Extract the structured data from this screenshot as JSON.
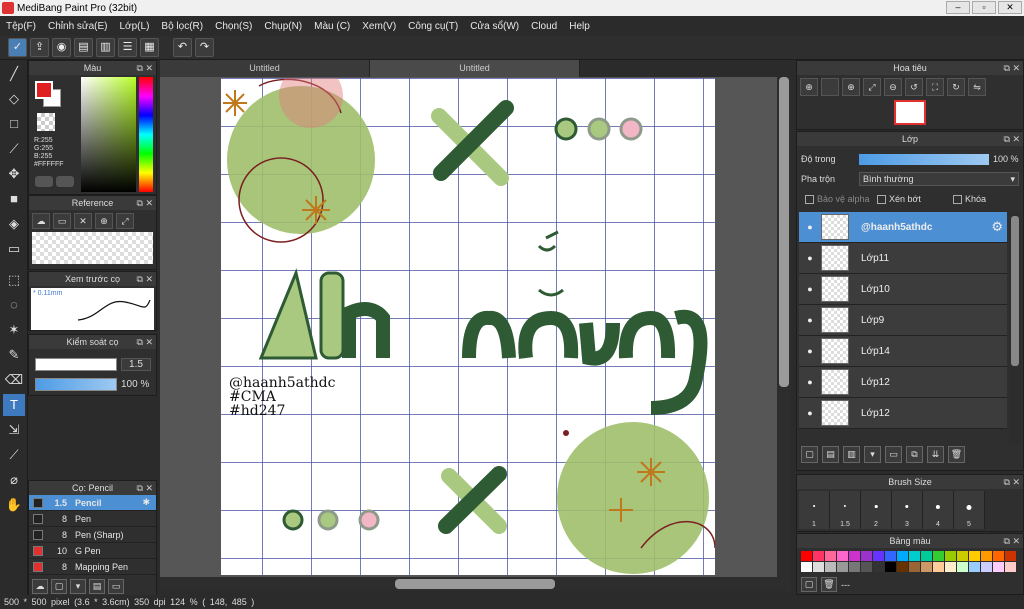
{
  "window": {
    "title": "MediBang Paint Pro (32bit)"
  },
  "menu": [
    "Tệp(F)",
    "Chỉnh sửa(E)",
    "Lớp(L)",
    "Bộ lọc(R)",
    "Chọn(S)",
    "Chụp(N)",
    "Màu (C)",
    "Xem(V)",
    "Công cụ(T)",
    "Cửa sổ(W)",
    "Cloud",
    "Help"
  ],
  "doc_tabs": [
    "Untitled",
    "Untitled"
  ],
  "color_panel": {
    "title": "Màu",
    "r": "R:255",
    "g": "G:255",
    "b": "B:255",
    "hex": "#FFFFFF",
    "fg_color": "#e02020",
    "bg_color": "#ffffff"
  },
  "reference_panel": {
    "title": "Reference"
  },
  "preview_panel": {
    "title": "Xem trước cọ",
    "size": "0.11mm"
  },
  "brush_control": {
    "title": "Kiểm soát cọ",
    "size_value": "1.5",
    "opacity_value": "100 %",
    "opacity": 1.0
  },
  "brush_list": {
    "title": "Cọ: Pencil",
    "items": [
      {
        "size": "1.5",
        "name": "Pencil",
        "color": "#222222",
        "selected": true
      },
      {
        "size": "8",
        "name": "Pen",
        "color": "#222222",
        "selected": false
      },
      {
        "size": "8",
        "name": "Pen (Sharp)",
        "color": "#222222",
        "selected": false
      },
      {
        "size": "10",
        "name": "G Pen",
        "color": "#e03030",
        "selected": false
      },
      {
        "size": "8",
        "name": "Mapping Pen",
        "color": "#e03030",
        "selected": false
      }
    ]
  },
  "canvas": {
    "title_art": "Ảnh nắng",
    "caption_lines": [
      "@haanh5athdc",
      "#CMA",
      "#hd247"
    ],
    "grid_color": "#4650a0",
    "accent_green": "#aacc88",
    "dark_green": "#2e5a34"
  },
  "status": {
    "size": "500 * 500 pixel",
    "cm": "(3.6 * 3.6cm)",
    "dpi": "350 dpi",
    "zoom": "124 %",
    "coords": "( 148, 485 )"
  },
  "navigator": {
    "title": "Hoa tiêu"
  },
  "layer_panel": {
    "title": "Lớp",
    "opacity_label": "Độ trong",
    "opacity_value": "100 %",
    "opacity": 1.0,
    "blend_label": "Pha trộn",
    "blend_value": "Bình thường",
    "protect_alpha": "Bảo vệ alpha",
    "clipping": "Xén bớt",
    "lock": "Khóa",
    "layers": [
      {
        "name": "@haanh5athdc",
        "selected": true
      },
      {
        "name": "Lớp11",
        "selected": false
      },
      {
        "name": "Lớp10",
        "selected": false
      },
      {
        "name": "Lớp9",
        "selected": false
      },
      {
        "name": "Lớp14",
        "selected": false
      },
      {
        "name": "Lớp12",
        "selected": false
      },
      {
        "name": "Lớp12",
        "selected": false
      }
    ]
  },
  "brush_size_panel": {
    "title": "Brush Size",
    "sizes": [
      1,
      1.5,
      2,
      3,
      4,
      5
    ]
  },
  "palette_panel": {
    "title": "Bảng màu",
    "footer_text": "---",
    "colors": [
      "#ff0000",
      "#ff3366",
      "#ff6699",
      "#ff66cc",
      "#cc33cc",
      "#9933cc",
      "#6633ff",
      "#3366ff",
      "#00aaff",
      "#00cccc",
      "#00cc99",
      "#33cc33",
      "#99cc00",
      "#cccc00",
      "#ffcc00",
      "#ff9900",
      "#ff6600",
      "#cc3300",
      "#ffffff",
      "#dddddd",
      "#bbbbbb",
      "#999999",
      "#777777",
      "#555555",
      "#333333",
      "#000000",
      "#663300",
      "#996633",
      "#cc9966",
      "#ffcc99",
      "#ffeecc",
      "#ccffcc",
      "#99ccff",
      "#ccccff",
      "#ffccff",
      "#ffcccc"
    ]
  }
}
